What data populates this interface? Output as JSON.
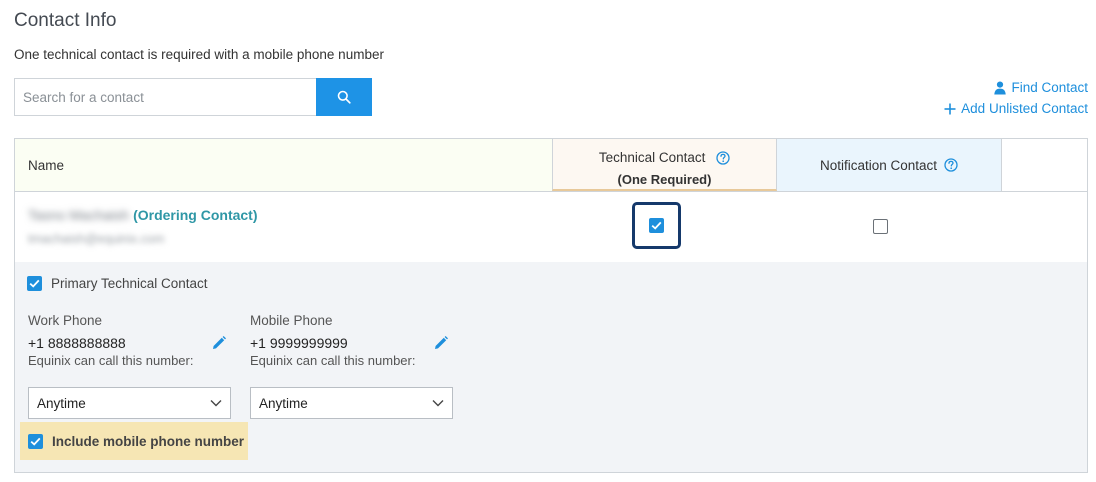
{
  "page": {
    "title": "Contact Info",
    "subtitle": "One technical contact is required with a mobile phone number"
  },
  "search": {
    "placeholder": "Search for a contact",
    "value": ""
  },
  "links": {
    "find_contact": "Find Contact",
    "add_unlisted": "Add Unlisted Contact"
  },
  "table": {
    "headers": {
      "name": "Name",
      "technical": "Technical Contact",
      "technical_sub": "(One Required)",
      "notification": "Notification Contact"
    },
    "rows": [
      {
        "name": "Tasno Machaish",
        "tag": "(Ordering Contact)",
        "email": "tmachaish@equinix.com",
        "technical_checked": true,
        "notification_checked": false
      }
    ]
  },
  "detail": {
    "primary_label": "Primary Technical Contact",
    "work_phone": {
      "label": "Work Phone",
      "number": "+1 8888888888",
      "call_label": "Equinix can call this number:",
      "call_value": "Anytime"
    },
    "mobile_phone": {
      "label": "Mobile Phone",
      "number": "+1 9999999999",
      "call_label": "Equinix can call this number:",
      "call_value": "Anytime"
    },
    "include_mobile_label": "Include mobile phone number"
  },
  "colors": {
    "accent": "#1e8fdc",
    "ordering_tag": "#2f97a6",
    "focus_ring": "#15396b",
    "highlight": "#f6e6b4"
  }
}
